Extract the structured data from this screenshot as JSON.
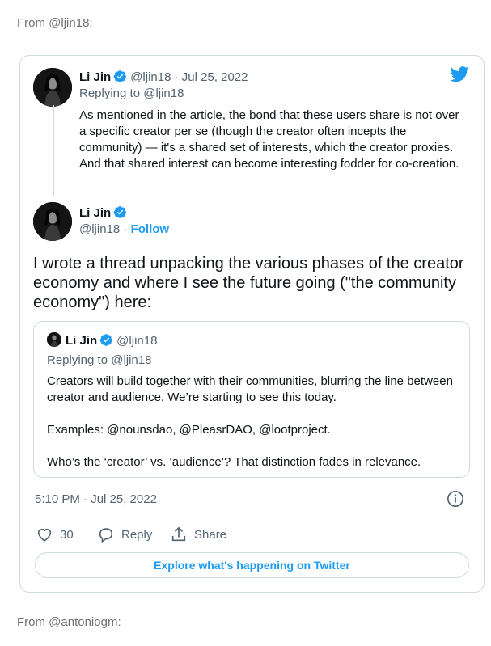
{
  "from_top": "From @ljin18:",
  "from_bottom": "From @antoniogm:",
  "colors": {
    "accent": "#1d9bf0",
    "muted": "#536471",
    "border": "#cfd9de",
    "text": "#0f1419"
  },
  "parent_tweet": {
    "name": "Li Jin",
    "handle_date": "@ljin18 · Jul 25, 2022",
    "replying_to": "Replying to @ljin18",
    "text": "As mentioned in the article, the bond that these users share is not over a specific creator per se (though the creator often incepts the community) — it's a shared set of interests, which the creator proxies. And that shared interest can become interesting fodder for co-creation."
  },
  "main_tweet": {
    "name": "Li Jin",
    "handle": "@ljin18 · ",
    "follow": "Follow",
    "text": "I wrote a thread unpacking the various phases of the creator economy and where I see the future going (\"the community economy\") here:",
    "quote": {
      "name": "Li Jin",
      "handle": "@ljin18",
      "replying_to": "Replying to @ljin18",
      "paragraphs": [
        "Creators will build together with their communities, blurring the line between creator and audience. We’re starting to see this today.",
        "Examples: @nounsdao, @PleasrDAO, @lootproject.",
        "Who’s the ‘creator’ vs. ‘audience’? That distinction fades in relevance."
      ]
    },
    "timestamp": "5:10 PM · Jul 25, 2022",
    "likes": "30",
    "reply_label": "Reply",
    "share_label": "Share",
    "explore_label": "Explore what's happening on Twitter"
  },
  "icons": [
    "twitter-logo-icon",
    "verified-badge-icon",
    "info-icon",
    "heart-icon",
    "reply-bubble-icon",
    "share-icon"
  ]
}
